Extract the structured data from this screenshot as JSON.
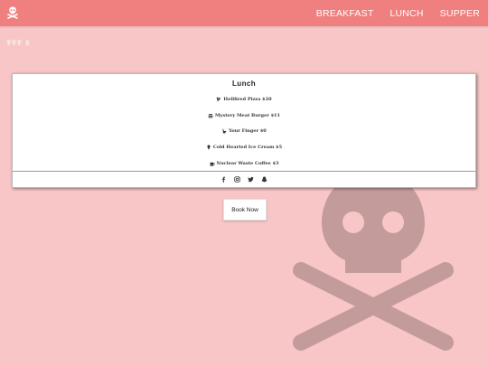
{
  "navbar": {
    "brand_icon": "skull-crossbones-icon",
    "links": [
      "BREAKFAST",
      "LUNCH",
      "SUPPER"
    ]
  },
  "logo_text": "¥¥¥ $",
  "menu_card": {
    "title": "Lunch",
    "items": [
      {
        "icon": "pizza-icon",
        "text": "Hellfired Pizza $20"
      },
      {
        "icon": "burger-icon",
        "text": "Mystery Meat Burger $11"
      },
      {
        "icon": "finger-icon",
        "text": "Your Finger $0"
      },
      {
        "icon": "ice-cream-icon",
        "text": "Cold Hearted Ice Cream $5"
      },
      {
        "icon": "coffee-icon",
        "text": "Nuclear Waste Coffee $3"
      }
    ],
    "social_icons": [
      "facebook-icon",
      "instagram-icon",
      "twitter-icon",
      "snapchat-icon"
    ]
  },
  "book_button": "Book Now",
  "colors": {
    "background": "#f8c6c6",
    "navbar": "#f07f7f",
    "skull_watermark": "#c49b9b"
  }
}
